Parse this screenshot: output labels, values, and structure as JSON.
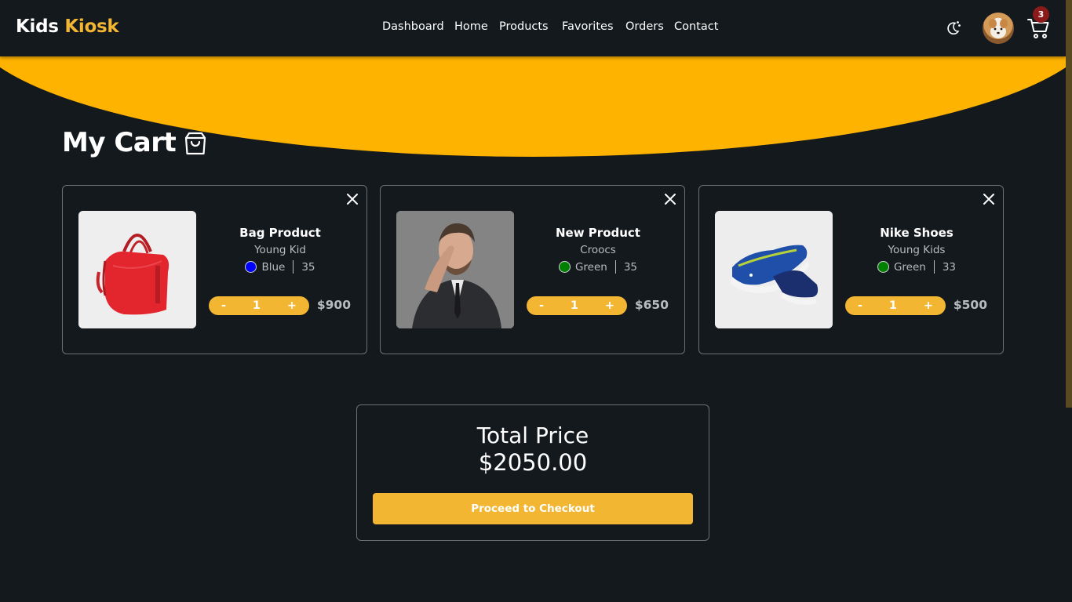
{
  "brand": {
    "first": "Kids",
    "second": "Kiosk"
  },
  "nav": {
    "links": [
      "Dashboard",
      "Home",
      "Products",
      "Favorites",
      "Orders",
      "Contact"
    ],
    "cart_count": "3",
    "theme_icon": "moon-icon",
    "cart_icon": "cart-icon"
  },
  "colors": {
    "background": "#14191e",
    "accent": "#f2b632",
    "hero": "#ffb301",
    "badge": "#8b1a1a"
  },
  "page": {
    "title": "My Cart",
    "title_icon": "shopping-bag-icon"
  },
  "cart": {
    "items": [
      {
        "name": "Bag Product",
        "brand": "Young Kid",
        "color_name": "Blue",
        "color_hex": "#0000ff",
        "size": "35",
        "quantity": "1",
        "minus": "-",
        "plus": "+",
        "price": "$900",
        "image": "red-handbag"
      },
      {
        "name": "New Product",
        "brand": "Croocs",
        "color_name": "Green",
        "color_hex": "#008000",
        "size": "35",
        "quantity": "1",
        "minus": "-",
        "plus": "+",
        "price": "$650",
        "image": "man-in-suit"
      },
      {
        "name": "Nike Shoes",
        "brand": "Young Kids",
        "color_name": "Green",
        "color_hex": "#008000",
        "size": "33",
        "quantity": "1",
        "minus": "-",
        "plus": "+",
        "price": "$500",
        "image": "blue-sneakers"
      }
    ]
  },
  "summary": {
    "label": "Total Price",
    "value": "$2050.00",
    "checkout_label": "Proceed to Checkout"
  }
}
